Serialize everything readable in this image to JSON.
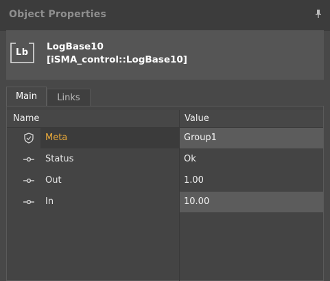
{
  "panel": {
    "title": "Object Properties",
    "icons": {
      "pin": "pin-icon"
    }
  },
  "object": {
    "icon_text": "Lb",
    "name": "LogBase10",
    "type": "[iSMA_control::LogBase10]"
  },
  "tabs": [
    {
      "label": "Main",
      "active": true
    },
    {
      "label": "Links",
      "active": false
    }
  ],
  "table": {
    "columns": [
      "Name",
      "Value"
    ],
    "rows": [
      {
        "name": "Meta",
        "value": "Group1",
        "icon": "shield-icon",
        "name_color": "#e8a93a"
      },
      {
        "name": "Status",
        "value": "Ok",
        "icon": "slot-connector-icon",
        "name_color": "#f0f0f0"
      },
      {
        "name": "Out",
        "value": "1.00",
        "icon": "slot-connector-icon",
        "name_color": "#f0f0f0"
      },
      {
        "name": "In",
        "value": "10.00",
        "icon": "slot-connector-icon",
        "name_color": "#f0f0f0"
      }
    ]
  },
  "colors": {
    "accent_meta": "#e8a93a",
    "editable_value_bg": "#5c5c5c"
  }
}
